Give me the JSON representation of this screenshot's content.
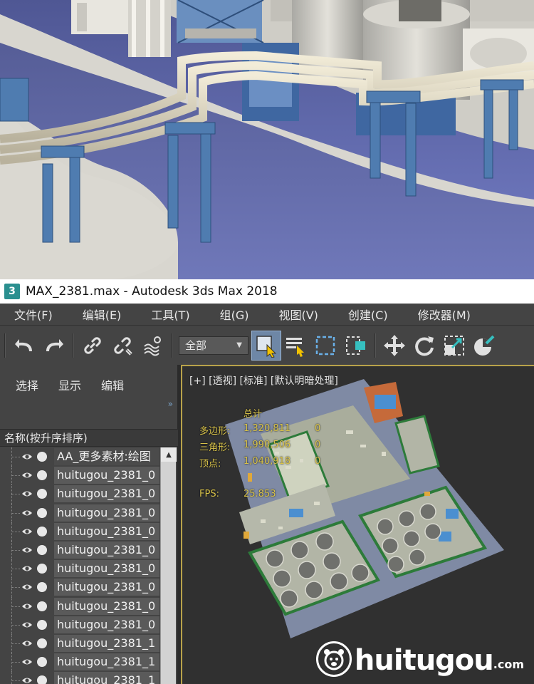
{
  "window": {
    "app_icon": "3",
    "title": "MAX_2381.max - Autodesk 3ds Max 2018"
  },
  "menu": [
    {
      "label": "文件(F)",
      "key": "file"
    },
    {
      "label": "编辑(E)",
      "key": "edit"
    },
    {
      "label": "工具(T)",
      "key": "tools"
    },
    {
      "label": "组(G)",
      "key": "group"
    },
    {
      "label": "视图(V)",
      "key": "views"
    },
    {
      "label": "创建(C)",
      "key": "create"
    },
    {
      "label": "修改器(M)",
      "key": "modifiers"
    }
  ],
  "toolbar": {
    "undo_icon": "undo-arrow-icon",
    "redo_icon": "redo-arrow-icon",
    "link_icon": "link-icon",
    "unlink_icon": "unlink-icon",
    "bind_spacewarp_icon": "bind-spacewarp-icon",
    "selection_filter": "全部",
    "select_object_icon": "select-cursor-icon",
    "select_by_name_icon": "select-by-name-icon",
    "rect_selection_icon": "rectangular-selection-icon",
    "window_crossing_icon": "window-crossing-icon",
    "move_icon": "move-icon",
    "rotate_icon": "rotate-icon",
    "scale_icon": "scale-icon",
    "material_icon": "material-icon"
  },
  "explorer": {
    "tabs": [
      "选择",
      "显示",
      "编辑"
    ],
    "column_header": "名称(按升序排序)",
    "items": [
      "AA_更多素材:绘图",
      "huitugou_2381_0",
      "huitugou_2381_0",
      "huitugou_2381_0",
      "huitugou_2381_0",
      "huitugou_2381_0",
      "huitugou_2381_0",
      "huitugou_2381_0",
      "huitugou_2381_0",
      "huitugou_2381_0",
      "huitugou_2381_1",
      "huitugou_2381_1",
      "huitugou_2381_1"
    ]
  },
  "viewport": {
    "label": "[+] [透视] [标准] [默认明暗处理]",
    "stats": {
      "header": "总计",
      "polygons_label": "多边形:",
      "polygons_value": "1,320,811",
      "polygons_sel": "0",
      "triangles_label": "三角形:",
      "triangles_value": "1,990,506",
      "triangles_sel": "0",
      "vertices_label": "顶点:",
      "vertices_value": "1,040,918",
      "vertices_sel": "0",
      "fps_label": "FPS:",
      "fps_value": "25.853"
    }
  },
  "watermark": {
    "text": "huitugou",
    "suffix": ".com",
    "logo_icon": "bear-face-icon"
  },
  "colors": {
    "menu_bg": "#444444",
    "viewport_border": "#b8a24a",
    "stats_text": "#d9c34a",
    "pipe_color": "#dcd5bf",
    "steel_blue": "#4f7cb0",
    "ground_blue": "#5d66a8"
  }
}
